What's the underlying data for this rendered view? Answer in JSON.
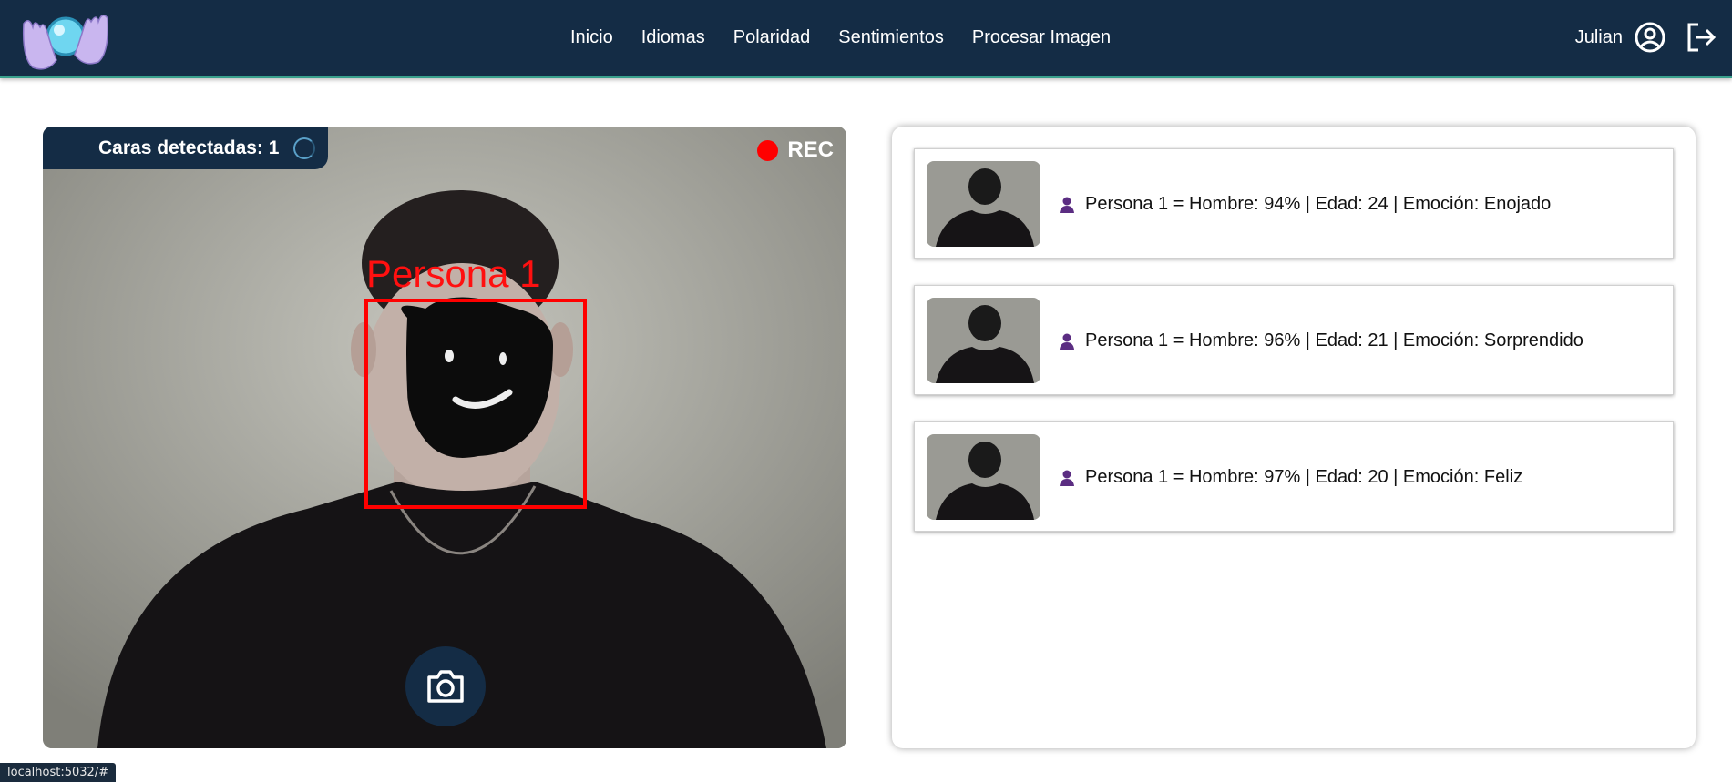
{
  "nav": {
    "links": [
      "Inicio",
      "Idiomas",
      "Polaridad",
      "Sentimientos",
      "Procesar Imagen"
    ],
    "user_name": "Julian",
    "icons": {
      "logo": "crystal-ball-hands-logo",
      "profile": "user-circle-icon",
      "logout": "logout-icon"
    }
  },
  "camera": {
    "faces_label": "Caras detectadas: 1",
    "rec_label": "REC",
    "face_label": "Persona 1",
    "capture_icon": "camera-icon"
  },
  "results": [
    {
      "text": "Persona 1 = Hombre: 94% | Edad: 24 | Emoción: Enojado"
    },
    {
      "text": "Persona 1 = Hombre: 96% | Edad: 21 | Emoción: Sorprendido"
    },
    {
      "text": "Persona 1 = Hombre: 97% | Edad: 20 | Emoción: Feliz"
    }
  ],
  "status_bar": {
    "url": "localhost:5032/#"
  },
  "colors": {
    "navbar": "#142c45",
    "accent": "#38a08c",
    "rec": "#ff0000",
    "person_icon": "#5b2d82"
  }
}
